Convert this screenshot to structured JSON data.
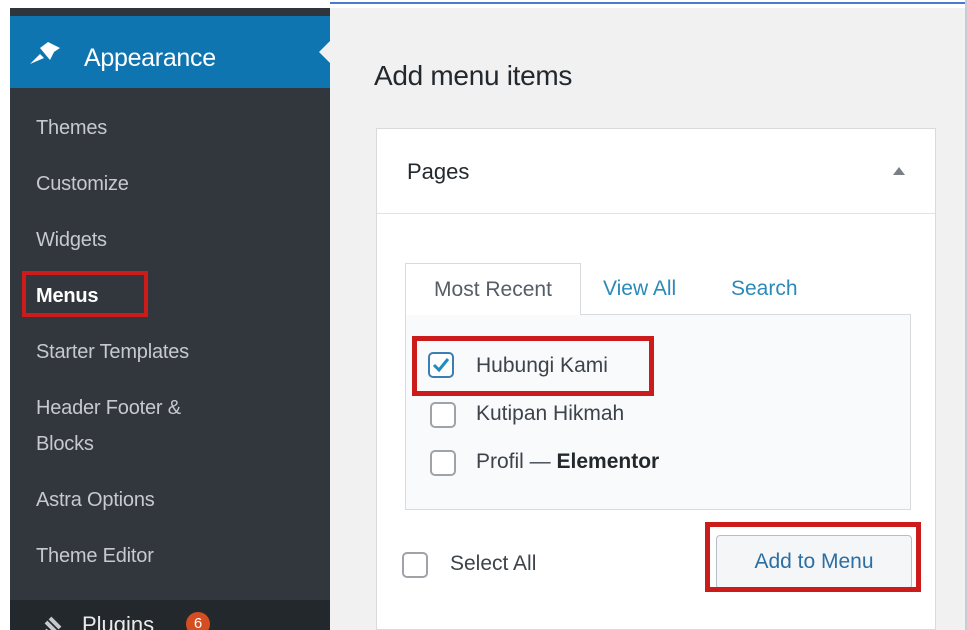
{
  "sidebar": {
    "active_menu": {
      "label": "Appearance",
      "icon": "paintbrush-pin-icon"
    },
    "items": [
      {
        "label": "Themes",
        "active": false
      },
      {
        "label": "Customize",
        "active": false
      },
      {
        "label": "Widgets",
        "active": false
      },
      {
        "label": "Menus",
        "active": true
      },
      {
        "label": "Starter Templates",
        "active": false
      },
      {
        "label": "Header Footer &",
        "active": false
      },
      {
        "label": "Blocks",
        "active": false
      },
      {
        "label": "Astra Options",
        "active": false
      },
      {
        "label": "Theme Editor",
        "active": false
      }
    ],
    "next_menu": {
      "label": "Plugins",
      "badge": "6",
      "icon": "plug-icon"
    }
  },
  "main": {
    "title": "Add menu items",
    "panel": {
      "title": "Pages",
      "tabs": [
        "Most Recent",
        "View All",
        "Search"
      ],
      "pages": [
        {
          "label": "Hubungi Kami",
          "suffix": "",
          "checked": true
        },
        {
          "label": "Kutipan Hikmah",
          "suffix": "",
          "checked": false
        },
        {
          "label": "Profil — ",
          "suffix": "Elementor",
          "checked": false
        }
      ],
      "select_all_label": "Select All",
      "add_button_label": "Add to Menu"
    }
  },
  "colors": {
    "sidebar_bg": "#32373d",
    "active_bg": "#0f75b0",
    "highlight_red": "#cc1b1b",
    "link_blue": "#2b8ab8"
  }
}
